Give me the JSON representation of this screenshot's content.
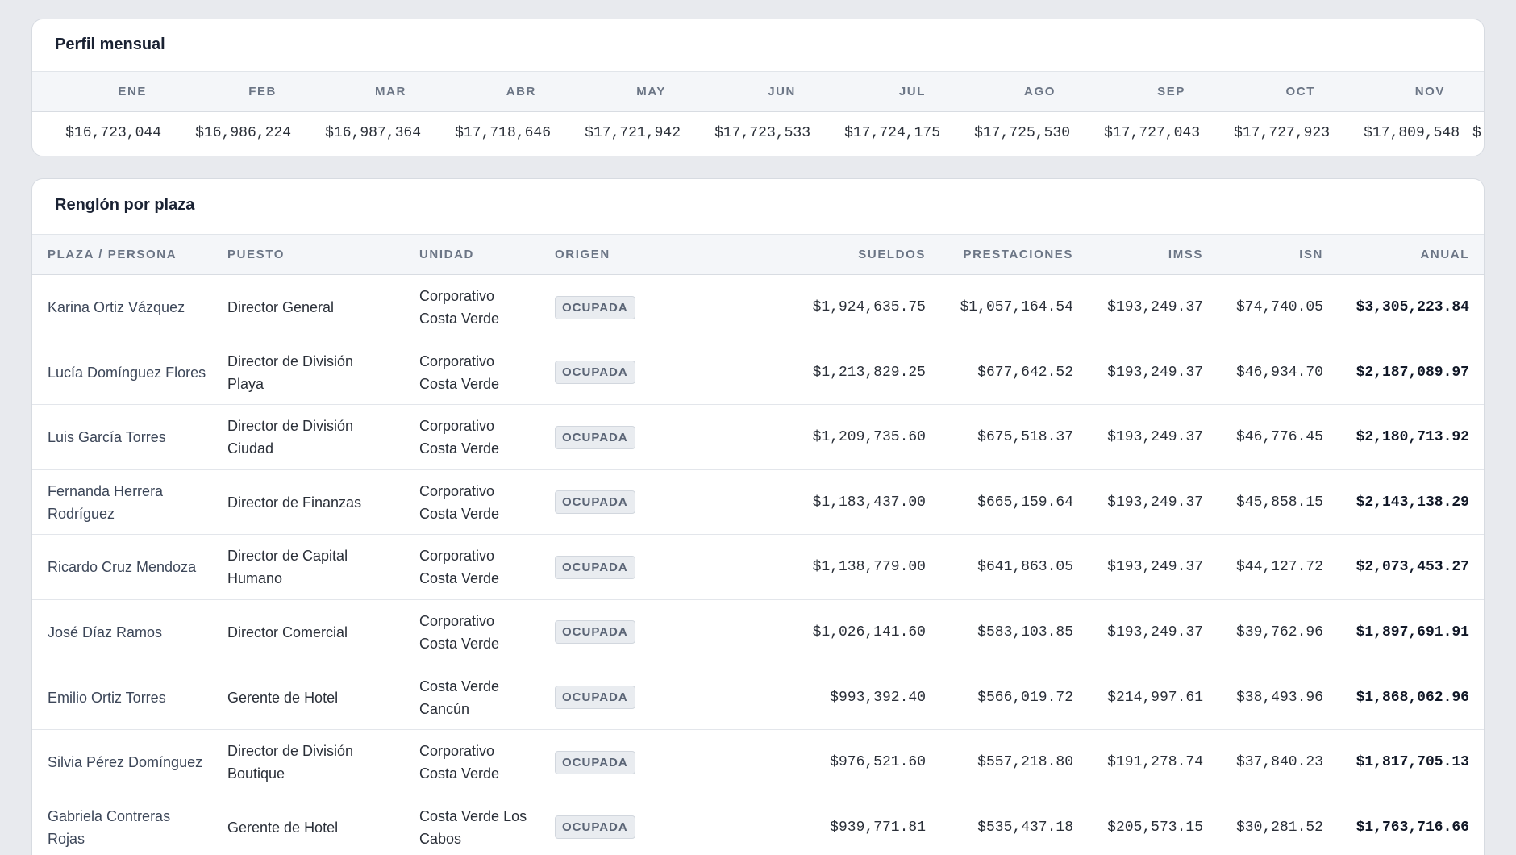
{
  "monthly": {
    "title": "Perfil mensual",
    "months": [
      {
        "label": "ENE",
        "value": "$16,723,044"
      },
      {
        "label": "FEB",
        "value": "$16,986,224"
      },
      {
        "label": "MAR",
        "value": "$16,987,364"
      },
      {
        "label": "ABR",
        "value": "$17,718,646"
      },
      {
        "label": "MAY",
        "value": "$17,721,942"
      },
      {
        "label": "JUN",
        "value": "$17,723,533"
      },
      {
        "label": "JUL",
        "value": "$17,724,175"
      },
      {
        "label": "AGO",
        "value": "$17,725,530"
      },
      {
        "label": "SEP",
        "value": "$17,727,043"
      },
      {
        "label": "OCT",
        "value": "$17,727,923"
      },
      {
        "label": "NOV",
        "value": "$17,809,548"
      },
      {
        "label": "",
        "value": "$"
      }
    ]
  },
  "plazas": {
    "title": "Renglón por plaza",
    "columns": {
      "persona": "PLAZA / PERSONA",
      "puesto": "PUESTO",
      "unidad": "UNIDAD",
      "origen": "ORIGEN",
      "sueldos": "SUELDOS",
      "prestaciones": "PRESTACIONES",
      "imss": "IMSS",
      "isn": "ISN",
      "anual": "ANUAL"
    },
    "rows": [
      {
        "persona": "Karina Ortiz Vázquez",
        "puesto": "Director General",
        "unidad": "Corporativo Costa Verde",
        "origen": "OCUPADA",
        "sueldos": "$1,924,635.75",
        "prestaciones": "$1,057,164.54",
        "imss": "$193,249.37",
        "isn": "$74,740.05",
        "anual": "$3,305,223.84"
      },
      {
        "persona": "Lucía Domínguez Flores",
        "puesto": "Director de División Playa",
        "unidad": "Corporativo Costa Verde",
        "origen": "OCUPADA",
        "sueldos": "$1,213,829.25",
        "prestaciones": "$677,642.52",
        "imss": "$193,249.37",
        "isn": "$46,934.70",
        "anual": "$2,187,089.97"
      },
      {
        "persona": "Luis García Torres",
        "puesto": "Director de División Ciudad",
        "unidad": "Corporativo Costa Verde",
        "origen": "OCUPADA",
        "sueldos": "$1,209,735.60",
        "prestaciones": "$675,518.37",
        "imss": "$193,249.37",
        "isn": "$46,776.45",
        "anual": "$2,180,713.92"
      },
      {
        "persona": "Fernanda Herrera Rodríguez",
        "puesto": "Director de Finanzas",
        "unidad": "Corporativo Costa Verde",
        "origen": "OCUPADA",
        "sueldos": "$1,183,437.00",
        "prestaciones": "$665,159.64",
        "imss": "$193,249.37",
        "isn": "$45,858.15",
        "anual": "$2,143,138.29"
      },
      {
        "persona": "Ricardo Cruz Mendoza",
        "puesto": "Director de Capital Humano",
        "unidad": "Corporativo Costa Verde",
        "origen": "OCUPADA",
        "sueldos": "$1,138,779.00",
        "prestaciones": "$641,863.05",
        "imss": "$193,249.37",
        "isn": "$44,127.72",
        "anual": "$2,073,453.27"
      },
      {
        "persona": "José Díaz Ramos",
        "puesto": "Director Comercial",
        "unidad": "Corporativo Costa Verde",
        "origen": "OCUPADA",
        "sueldos": "$1,026,141.60",
        "prestaciones": "$583,103.85",
        "imss": "$193,249.37",
        "isn": "$39,762.96",
        "anual": "$1,897,691.91"
      },
      {
        "persona": "Emilio Ortiz Torres",
        "puesto": "Gerente de Hotel",
        "unidad": "Costa Verde Cancún",
        "origen": "OCUPADA",
        "sueldos": "$993,392.40",
        "prestaciones": "$566,019.72",
        "imss": "$214,997.61",
        "isn": "$38,493.96",
        "anual": "$1,868,062.96"
      },
      {
        "persona": "Silvia Pérez Domínguez",
        "puesto": "Director de División Boutique",
        "unidad": "Corporativo Costa Verde",
        "origen": "OCUPADA",
        "sueldos": "$976,521.60",
        "prestaciones": "$557,218.80",
        "imss": "$191,278.74",
        "isn": "$37,840.23",
        "anual": "$1,817,705.13"
      },
      {
        "persona": "Gabriela Contreras Rojas",
        "puesto": "Gerente de Hotel",
        "unidad": "Costa Verde Los Cabos",
        "origen": "OCUPADA",
        "sueldos": "$939,771.81",
        "prestaciones": "$535,437.18",
        "imss": "$205,573.15",
        "isn": "$30,281.52",
        "anual": "$1,763,716.66"
      }
    ]
  }
}
